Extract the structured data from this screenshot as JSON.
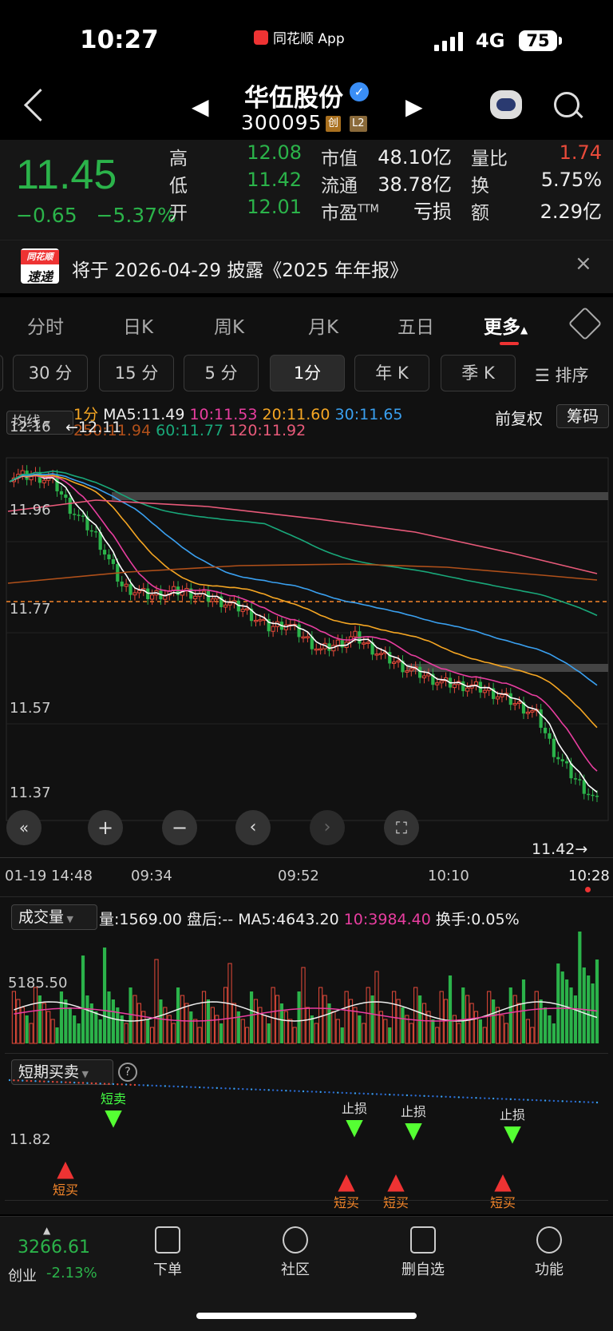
{
  "status_bar": {
    "time": "10:27",
    "app_badge": "同花顺 App",
    "network": "4G",
    "battery": "75"
  },
  "header": {
    "stock_name": "华伍股份",
    "stock_code": "300095",
    "tags": [
      "创",
      "L2"
    ]
  },
  "quote": {
    "price": "11.45",
    "change": "−0.65",
    "change_pct": "−5.37%",
    "stats": [
      {
        "label": "高",
        "value": "12.08"
      },
      {
        "label": "低",
        "value": "11.42"
      },
      {
        "label": "开",
        "value": "12.01"
      },
      {
        "label": "市值",
        "value": "48.10亿"
      },
      {
        "label": "流通",
        "value": "38.78亿"
      },
      {
        "label": "市盈",
        "value": "亏损"
      },
      {
        "label": "量比",
        "value": "1.74"
      },
      {
        "label": "换",
        "value": "5.75%"
      },
      {
        "label": "额",
        "value": "2.29亿"
      }
    ],
    "pe_suffix": "TTM"
  },
  "notice": {
    "logo_top": "同花顺",
    "logo_bottom": "速递",
    "text": "将于 2026-04-29 披露《2025 年年报》",
    "close": "×"
  },
  "period_tabs": [
    "分时",
    "日K",
    "周K",
    "月K",
    "五日",
    "更多"
  ],
  "sub_tabs": [
    "30 分",
    "15 分",
    "5 分",
    "1分",
    "年 K",
    "季 K",
    "排序"
  ],
  "chart": {
    "indicator_select": "均线",
    "ma_legend": {
      "period": "1分",
      "ma5": "MA5:11.49",
      "ma10": "10:11.53",
      "ma20": "20:11.60",
      "ma30": "30:11.65",
      "ma250": "250:11.94",
      "ma60": "60:11.77",
      "ma120": "120:11.92"
    },
    "right_controls": {
      "adjust": "前复权",
      "chips": "筹码"
    },
    "y_labels": [
      "12.16",
      "11.96",
      "11.77",
      "11.57",
      "11.37"
    ],
    "high_marker": "←12.11",
    "low_marker": "11.42→",
    "x_labels": [
      "01-19 14:48",
      "09:34",
      "09:52",
      "10:10",
      "10:28"
    ],
    "colors": {
      "up": "#e84a3a",
      "down": "#2bb34a",
      "ma5": "#ffffff",
      "ma10": "#e83ea0",
      "ma20": "#f5a623",
      "ma30": "#3aa0f0",
      "ma60": "#19a87a",
      "ma120": "#e85a7a",
      "ma250": "#b0501a"
    }
  },
  "volume": {
    "select": "成交量",
    "vol": "量:1569.00",
    "after": "盘后:--",
    "ma5": "MA5:4643.20",
    "ma10": "10:3984.40",
    "turnover": "换手:0.05%",
    "y_label": "5185.50"
  },
  "signals": {
    "select": "短期买卖",
    "help": "?",
    "y_label": "11.82",
    "markers": [
      {
        "type": "buy",
        "label": "短买"
      },
      {
        "type": "sell",
        "label": "短卖"
      },
      {
        "type": "stop",
        "label": "止损"
      },
      {
        "type": "buy",
        "label": "短买"
      },
      {
        "type": "stop",
        "label": "止损"
      },
      {
        "type": "buy",
        "label": "短买"
      },
      {
        "type": "stop",
        "label": "止损"
      },
      {
        "type": "buy",
        "label": "短买"
      }
    ]
  },
  "footer": {
    "index_value": "3266.61",
    "index_name": "创业",
    "index_change": "-2.13%",
    "tabs": [
      "下单",
      "社区",
      "删自选",
      "功能"
    ]
  }
}
